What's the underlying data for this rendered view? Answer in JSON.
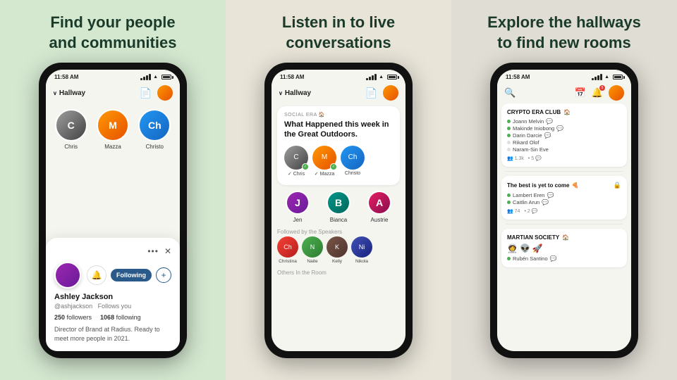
{
  "panels": [
    {
      "id": "left",
      "title": "Find your people\nand communities",
      "phone": {
        "time": "11:58 AM",
        "screen": "hallway",
        "hallway_label": "Hallway",
        "avatars": [
          {
            "name": "Chris",
            "initials": "C",
            "color": "av-gray"
          },
          {
            "name": "Mazza",
            "initials": "M",
            "color": "av-orange"
          },
          {
            "name": "Christo",
            "initials": "Ch",
            "color": "av-blue"
          }
        ],
        "profile_card": {
          "name": "Ashley Jackson",
          "handle": "@ashjackson",
          "follows_you": "Follows you",
          "followers_label": "followers",
          "followers_count": "250",
          "following_label": "following",
          "following_count": "1068",
          "bio": "Director of Brand at Radius. Ready to meet more people in 2021.",
          "following_btn": "Following",
          "bell": "🔔",
          "plus": "+"
        }
      }
    },
    {
      "id": "mid",
      "title": "Listen in to live\nconversations",
      "phone": {
        "time": "11:58 AM",
        "hallway_label": "Hallway",
        "room": {
          "source": "SOCIAL ERA 🏠",
          "title": "What Happened this week in the Great Outdoors.",
          "speakers": [
            {
              "name": "Chris",
              "initials": "C",
              "color": "av-gray"
            },
            {
              "name": "Mazza",
              "initials": "M",
              "color": "av-orange"
            },
            {
              "name": "Christo",
              "initials": "Ch",
              "color": "av-blue"
            }
          ]
        },
        "second_row_label": "",
        "second_row": [
          {
            "name": "Jen",
            "initials": "J",
            "color": "av-purple"
          },
          {
            "name": "Bianca",
            "initials": "B",
            "color": "av-teal"
          },
          {
            "name": "Austrie",
            "initials": "A",
            "color": "av-pink"
          }
        ],
        "followed_label": "Followed by the Speakers",
        "followers_row": [
          {
            "name": "Christina",
            "initials": "Ch",
            "color": "av-red"
          },
          {
            "name": "Naite",
            "initials": "N",
            "color": "av-green"
          },
          {
            "name": "Kelly",
            "initials": "K",
            "color": "av-brown"
          },
          {
            "name": "Nikola",
            "initials": "Ni",
            "color": "av-indigo"
          }
        ],
        "others_label": "Others In the Room"
      }
    },
    {
      "id": "right",
      "title": "Explore the hallways\nto find new rooms",
      "phone": {
        "time": "11:58 AM",
        "hallways": [
          {
            "name": "CRYPTO ERA CLUB",
            "emoji": "🏠",
            "members": [
              {
                "name": "Joann Melvin",
                "has_icon": true
              },
              {
                "name": "Makinde Iniobong",
                "has_icon": true
              },
              {
                "name": "Darin Darcie",
                "has_icon": true
              },
              {
                "name": "Rikard Olof"
              },
              {
                "name": "Naram-Sin Eve"
              }
            ],
            "listeners": "1.3k",
            "rooms": "5",
            "locked": false
          },
          {
            "name": "The best is yet to come",
            "emoji": "🍕",
            "members": [
              {
                "name": "Lambert Eren",
                "has_icon": true
              },
              {
                "name": "Caitlin Arun",
                "has_icon": true
              }
            ],
            "listeners": "74",
            "rooms": "2",
            "locked": true
          },
          {
            "name": "MARTIAN SOCIETY",
            "emoji": "🏠",
            "members": [
              {
                "name": "Rubén Santino"
              }
            ],
            "listeners": "",
            "rooms": "",
            "locked": false
          }
        ],
        "notif_count": "5"
      }
    }
  ]
}
